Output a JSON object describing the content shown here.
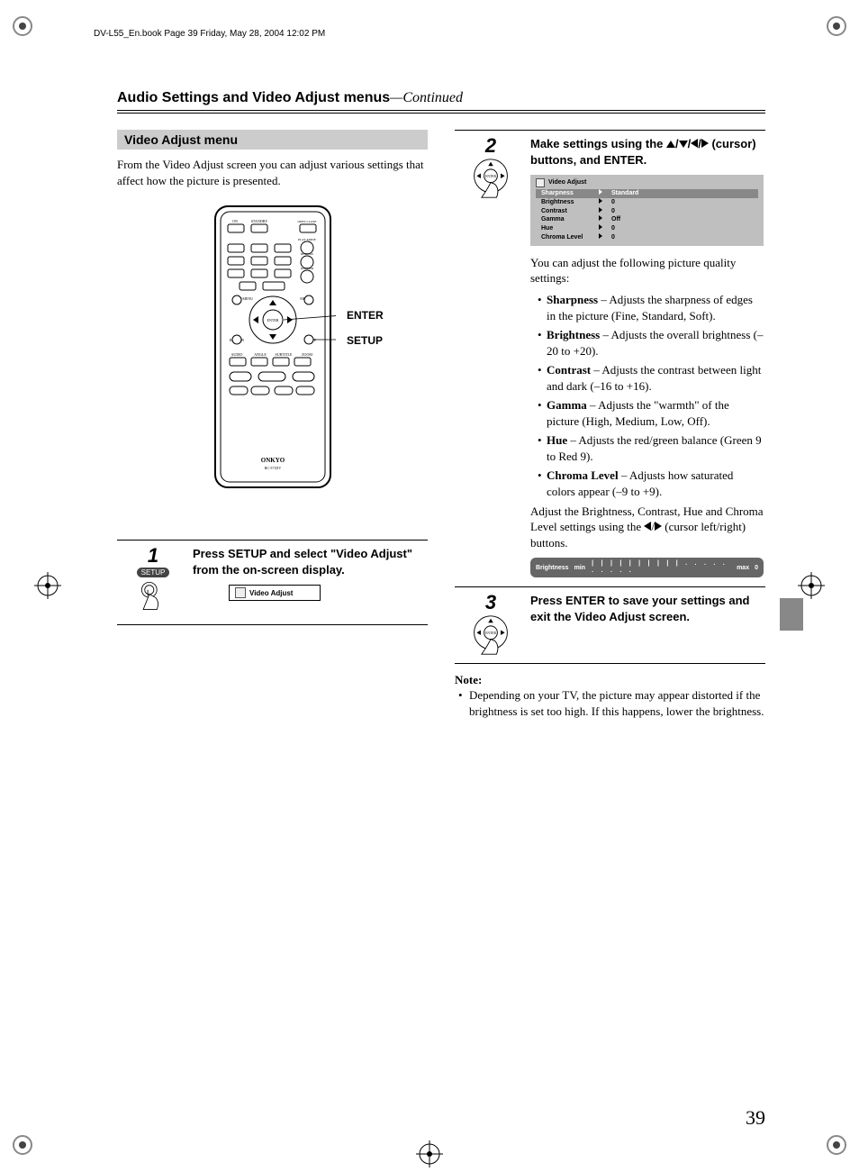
{
  "header": {
    "book_line": "DV-L55_En.book  Page 39  Friday, May 28, 2004  12:02 PM"
  },
  "title": {
    "main": "Audio Settings and Video Adjust menus",
    "cont": "—Continued"
  },
  "left": {
    "heading": "Video Adjust menu",
    "intro": "From the Video Adjust screen you can adjust various settings that affect how the picture is presented.",
    "remote_labels": {
      "enter": "ENTER",
      "setup": "SETUP"
    },
    "remote_text": {
      "on": "ON",
      "standby": "STANDBY",
      "open": "OPEN CLOSE",
      "play_mode": "PLAY MODE",
      "display": "DISPLAY",
      "dimmer": "DIMMER",
      "top_menu": "TOP MENU",
      "menu": "MENU",
      "enter": "ENTER",
      "return": "RETURN",
      "setup": "SETUP",
      "audio": "AUDIO",
      "angle": "ANGLE",
      "subtitle": "SUBTITLE",
      "zoom": "ZOOM",
      "brand": "ONKYO",
      "model": "RC-571DV"
    }
  },
  "steps": {
    "s1": {
      "num": "1",
      "icon_label": "SETUP",
      "instruction": "Press SETUP and select \"Video Adjust\" from the on-screen display.",
      "tag": "Video Adjust"
    },
    "s2": {
      "num": "2",
      "instruction_pre": "Make settings using the ",
      "instruction_post": " (cursor) buttons, and ENTER.",
      "osd": {
        "title": "Video Adjust",
        "rows": [
          {
            "name": "Sharpness",
            "val": "Standard",
            "hi": true
          },
          {
            "name": "Brightness",
            "val": "0"
          },
          {
            "name": "Contrast",
            "val": "0"
          },
          {
            "name": "Gamma",
            "val": "Off"
          },
          {
            "name": "Hue",
            "val": "0"
          },
          {
            "name": "Chroma Level",
            "val": "0"
          }
        ]
      },
      "body_intro": "You can adjust the following picture quality settings:",
      "items": [
        {
          "name": "Sharpness",
          "desc": " – Adjusts the sharpness of edges in the picture (Fine, Standard, Soft)."
        },
        {
          "name": "Brightness",
          "desc": " – Adjusts the overall brightness (–20 to +20)."
        },
        {
          "name": "Contrast",
          "desc": " – Adjusts the contrast between light and dark (–16 to +16)."
        },
        {
          "name": "Gamma",
          "desc": " – Adjusts the \"warmth\" of the picture (High, Medium, Low, Off)."
        },
        {
          "name": "Hue",
          "desc": " – Adjusts the red/green balance (Green 9 to Red 9)."
        },
        {
          "name": "Chroma Level",
          "desc": " – Adjusts how saturated colors appear (–9 to +9)."
        }
      ],
      "body_after_pre": "Adjust the Brightness, Contrast, Hue and Chroma Level settings using the ",
      "body_after_post": " (cursor left/right) buttons.",
      "slider": {
        "label": "Brightness",
        "min": "min",
        "max": "max",
        "val": "0",
        "ticks": "| | | | | | | | | | . . . . . . . . . ."
      }
    },
    "s3": {
      "num": "3",
      "instruction": "Press ENTER to save your settings and exit the Video Adjust screen."
    }
  },
  "note": {
    "head": "Note:",
    "item": "Depending on your TV, the picture may appear distorted if the brightness is set too high. If this happens, lower the brightness."
  },
  "page_number": "39"
}
